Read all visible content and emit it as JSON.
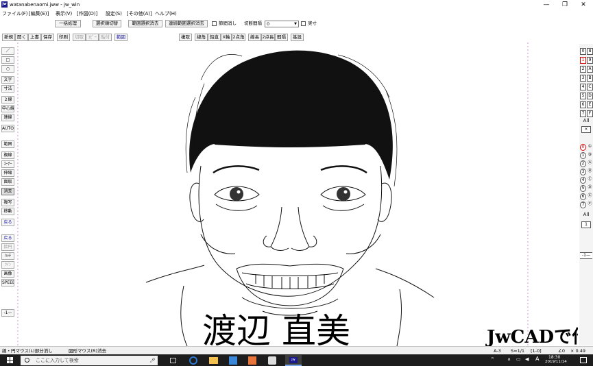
{
  "window": {
    "title": "watanabenaomi.jww - jw_win",
    "logo": "jw",
    "controls": {
      "minimize": "—",
      "maximize": "❐",
      "close": "✕"
    }
  },
  "menu": [
    "ファイル(F)",
    "[編集(E)]",
    "表示(V)",
    "[作図(D)]",
    "設定(S)",
    "[その他(A)]",
    "ヘルプ(H)"
  ],
  "toolbar1": {
    "batch": "一括処理",
    "select_toggle": "選択順切替",
    "range_clear": "範囲選択消去",
    "consecutive_clear": "連続範囲選択消去",
    "chk_node": "節間消し",
    "label_interval": "切断間隔",
    "interval_value": "0",
    "chk_real": "実寸"
  },
  "toolbar2": {
    "left": [
      "新規",
      "開く",
      "上書",
      "保存",
      "印刷",
      "切取",
      "ｺﾋﾟｰ",
      "貼付",
      "範囲"
    ],
    "right": [
      "複取",
      "線角",
      "鉛直",
      "X軸",
      "2点角",
      "線長",
      "2点長",
      "間隔",
      "基設"
    ]
  },
  "left_tools": [
    "／",
    "□",
    "○",
    "文字",
    "寸法",
    "２線",
    "中心線",
    "連線",
    "AUTO",
    "範囲",
    "複線",
    "ｺｰﾅｰ",
    "伸縮",
    "面取",
    "消去",
    "複写",
    "移動",
    "戻る",
    "戻る",
    "接円",
    "ﾊｯﾁ",
    "ﾂｲﾝ",
    "画像",
    "SPEED",
    "-1—"
  ],
  "layer_groups": [
    "0",
    "8",
    "1",
    "9",
    "2",
    "A",
    "3",
    "B",
    "4",
    "C",
    "5",
    "D",
    "6",
    "E",
    "7",
    "F"
  ],
  "layer_all": "All",
  "layer_x": "×",
  "layers": [
    "0",
    "①",
    "1",
    "⑨",
    "2",
    "Ⓐ",
    "3",
    "Ⓑ",
    "4",
    "Ⓒ",
    "5",
    "Ⓓ",
    "6",
    "Ⓔ",
    "7",
    "Ⓕ"
  ],
  "layer_all2": "All",
  "layer_one": "1",
  "layer_scale": "-1—",
  "canvas": {
    "name_text": "渡辺 直美",
    "brand_text": "JwCADで作図"
  },
  "status": {
    "left": "線・円マウス(L)部分消し",
    "left2": "図形マウス(R)消去",
    "right": [
      "A-3",
      "S=1/1",
      "[1-0]",
      "∠0",
      "× 0.49"
    ]
  },
  "taskbar": {
    "search_placeholder": "ここに入力して検索",
    "time": "18:30",
    "date": "2019/11/14",
    "ime": "A"
  }
}
